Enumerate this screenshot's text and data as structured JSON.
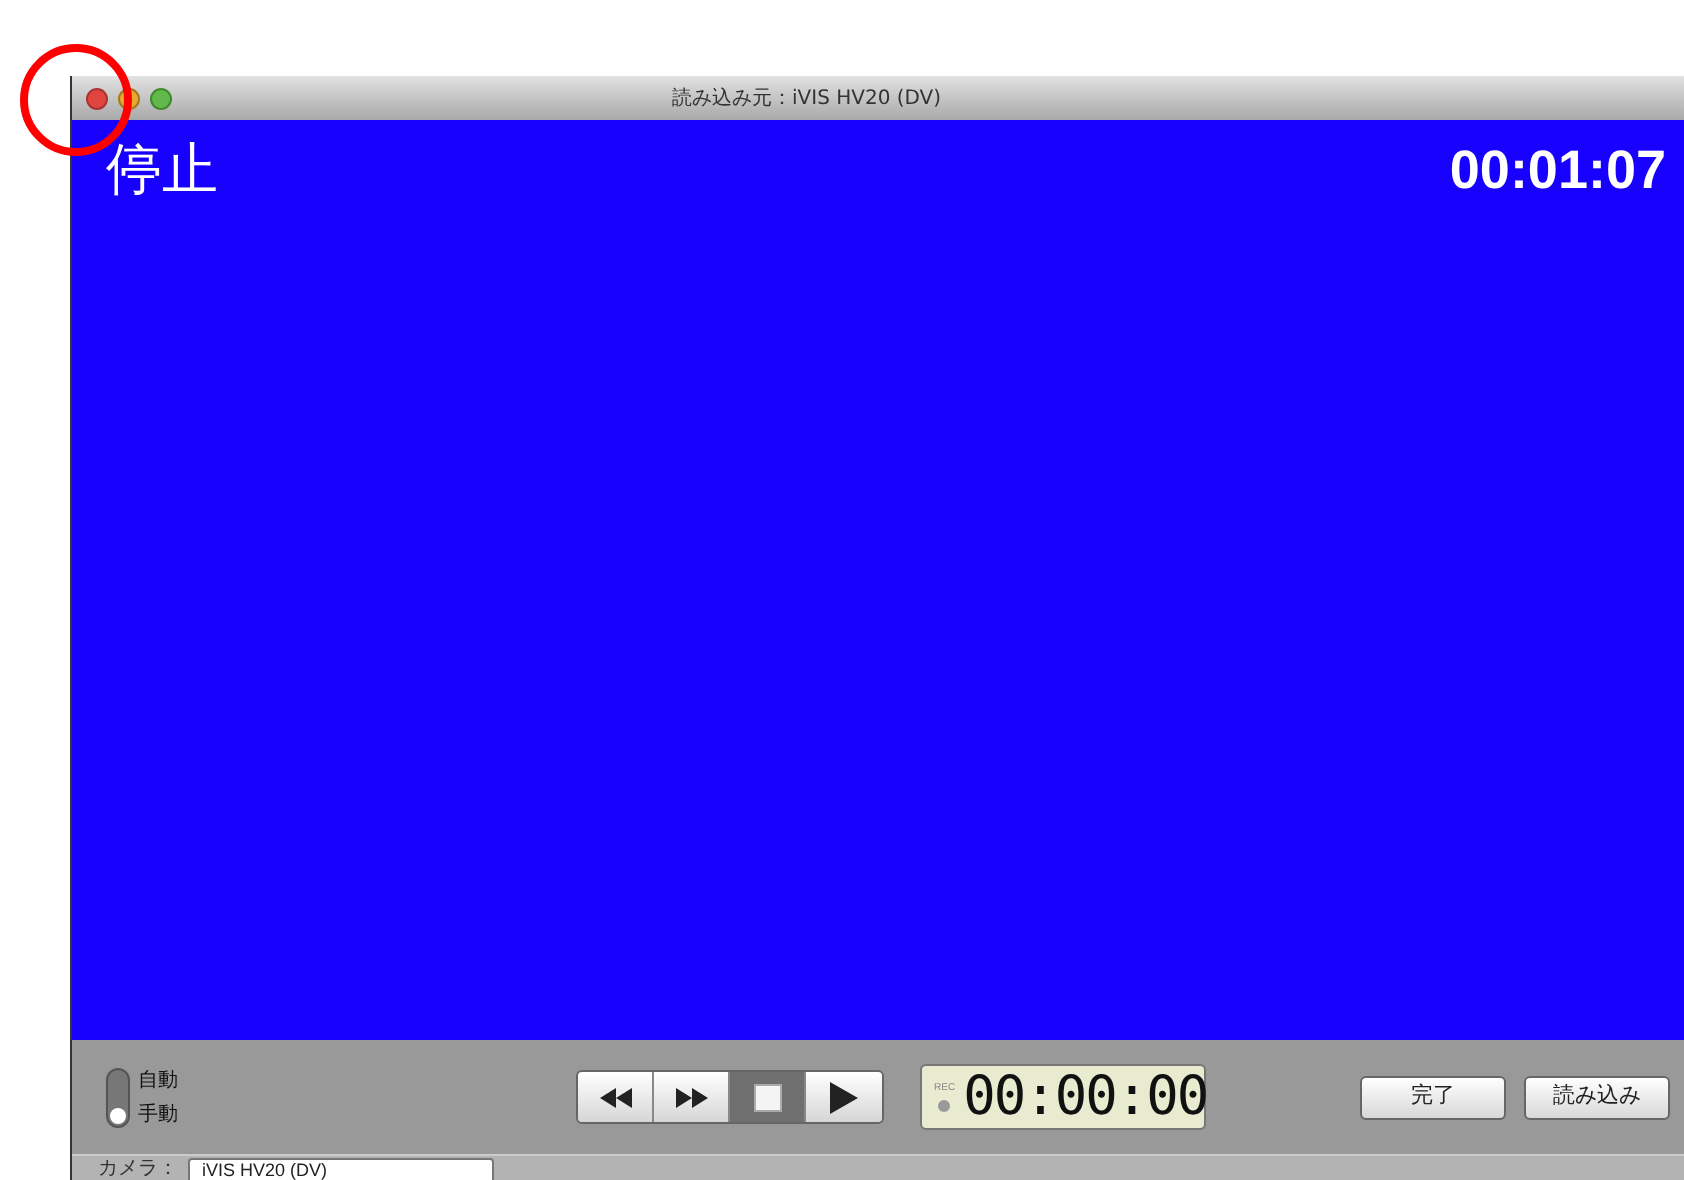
{
  "window": {
    "title": "読み込み元：iVIS HV20 (DV)"
  },
  "video": {
    "status": "停止",
    "timecode": "00:01:07"
  },
  "mode_switch": {
    "options": [
      {
        "label": "自動",
        "selected": false
      },
      {
        "label": "手動",
        "selected": true
      }
    ]
  },
  "transport": [
    {
      "kind": "rewind",
      "selected": false
    },
    {
      "kind": "forward",
      "selected": false
    },
    {
      "kind": "stop",
      "selected": true
    },
    {
      "kind": "play",
      "selected": false
    }
  ],
  "counter": {
    "rec_label": "REC",
    "recording": false,
    "time": "00:00:00"
  },
  "buttons": [
    "完了",
    "読み込み"
  ],
  "camera": {
    "label": "カメラ：",
    "value": "iVIS HV20 (DV)"
  }
}
